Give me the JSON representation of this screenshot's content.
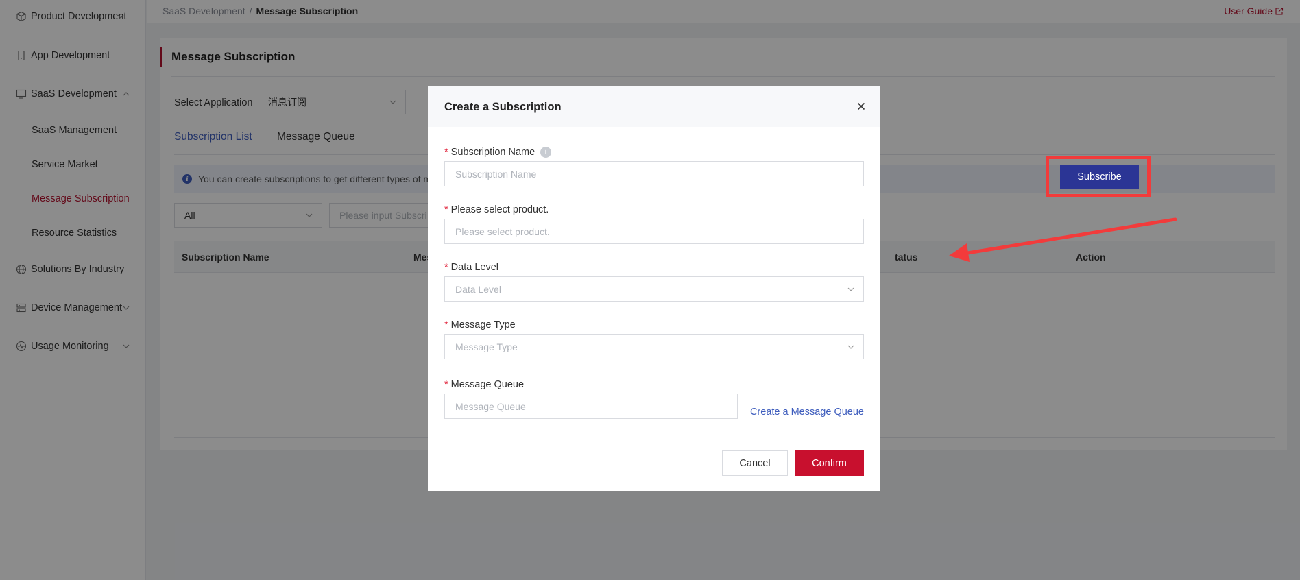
{
  "sidebar": {
    "items": [
      {
        "label": "Product Development",
        "icon": "cube-icon"
      },
      {
        "label": "App Development",
        "icon": "phone-icon"
      },
      {
        "label": "SaaS Development",
        "icon": "monitor-icon"
      },
      {
        "label": "Solutions By Industry",
        "icon": "globe-icon"
      },
      {
        "label": "Device Management",
        "icon": "server-icon"
      },
      {
        "label": "Usage Monitoring",
        "icon": "pulse-icon"
      }
    ],
    "sub_items": [
      {
        "label": "SaaS Management"
      },
      {
        "label": "Service Market"
      },
      {
        "label": "Message Subscription"
      },
      {
        "label": "Resource Statistics"
      }
    ]
  },
  "header": {
    "breadcrumb_parent": "SaaS Development",
    "breadcrumb_sep": "/",
    "breadcrumb_current": "Message Subscription",
    "user_guide": "User Guide"
  },
  "page": {
    "title": "Message Subscription",
    "select_app_label": "Select Application",
    "select_app_value": "消息订阅",
    "tabs": [
      {
        "label": "Subscription List",
        "active": true
      },
      {
        "label": "Message Queue",
        "active": false
      }
    ],
    "info_text": "You can create subscriptions to get different types of m",
    "filter_value": "All",
    "search_placeholder": "Please input Subscri",
    "subscribe_button": "Subscribe",
    "columns": [
      "Subscription Name",
      "Mes",
      "tatus",
      "Action"
    ]
  },
  "modal": {
    "title": "Create a Subscription",
    "fields": [
      {
        "label": "Subscription Name",
        "placeholder": "Subscription Name"
      },
      {
        "label": "Please select product.",
        "placeholder": "Please select product."
      },
      {
        "label": "Data Level",
        "placeholder": "Data Level"
      },
      {
        "label": "Message Type",
        "placeholder": "Message Type"
      },
      {
        "label": "Message Queue",
        "placeholder": "Message Queue"
      }
    ],
    "required_mark": "*",
    "create_queue_link": "Create a Message Queue",
    "cancel": "Cancel",
    "confirm": "Confirm"
  },
  "colors": {
    "brand_red": "#c8102e",
    "primary_blue": "#2b3595",
    "link_blue": "#3e5dbd",
    "annotation_red": "#f23b3b"
  }
}
